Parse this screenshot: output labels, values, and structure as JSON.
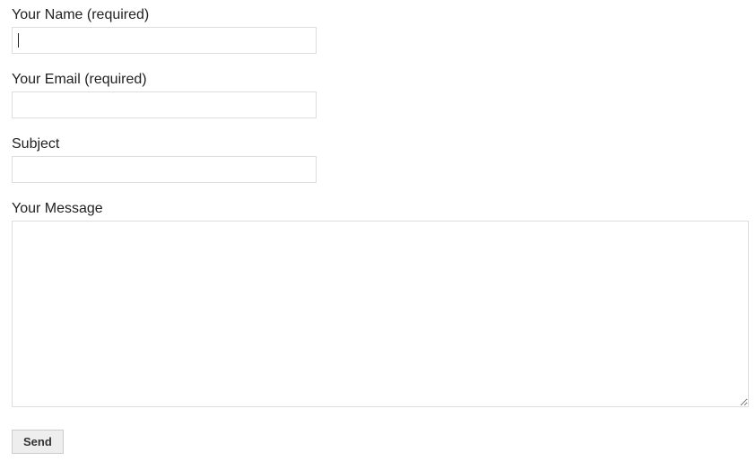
{
  "form": {
    "name": {
      "label": "Your Name (required)",
      "value": ""
    },
    "email": {
      "label": "Your Email (required)",
      "value": ""
    },
    "subject": {
      "label": "Subject",
      "value": ""
    },
    "message": {
      "label": "Your Message",
      "value": ""
    },
    "submit_label": "Send"
  }
}
